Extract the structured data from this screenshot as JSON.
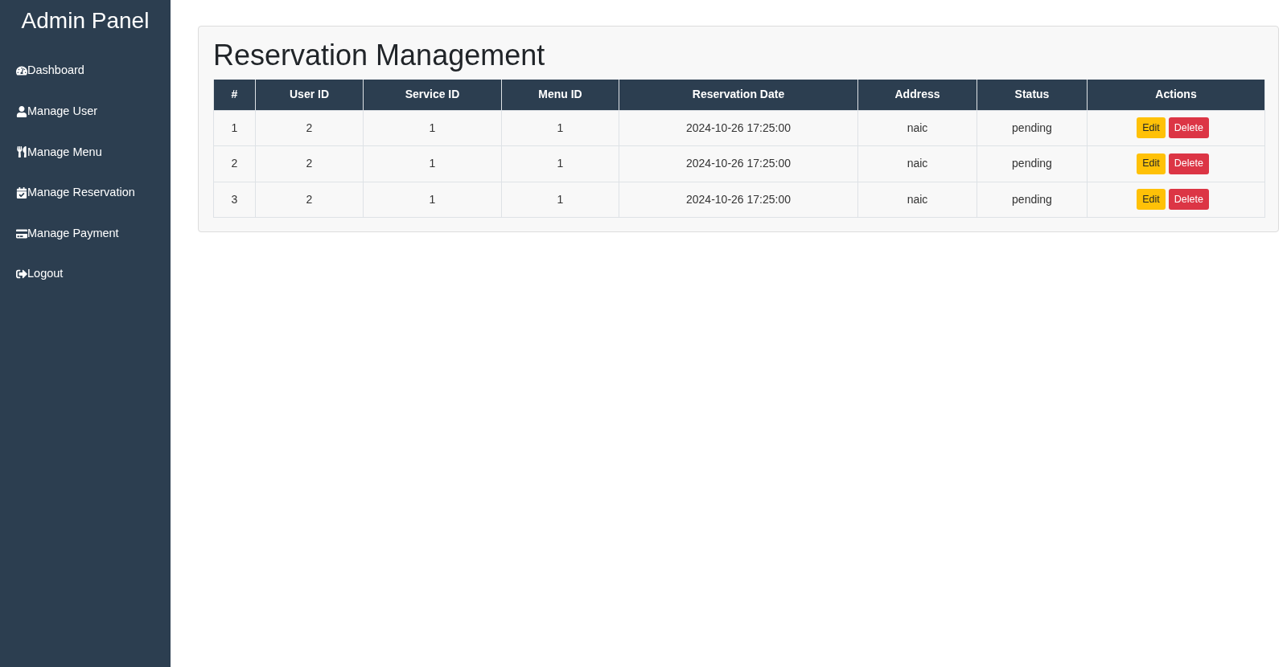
{
  "sidebar": {
    "title": "Admin Panel",
    "items": [
      {
        "kind": "dashboard",
        "label": "Dashboard"
      },
      {
        "kind": "user",
        "label": "Manage User"
      },
      {
        "kind": "menu",
        "label": "Manage Menu"
      },
      {
        "kind": "reservation",
        "label": "Manage Reservation"
      },
      {
        "kind": "payment",
        "label": "Manage Payment"
      },
      {
        "kind": "logout",
        "label": "Logout"
      }
    ]
  },
  "main": {
    "title": "Reservation Management",
    "table": {
      "columns": [
        "#",
        "User ID",
        "Service ID",
        "Menu ID",
        "Reservation Date",
        "Address",
        "Status",
        "Actions"
      ],
      "rows": [
        {
          "cells": [
            "1",
            "2",
            "1",
            "1",
            "2024-10-26 17:25:00",
            "naic",
            "pending"
          ],
          "actions": [
            {
              "kind": "edit",
              "label": "Edit"
            },
            {
              "kind": "delete",
              "label": "Delete"
            }
          ]
        },
        {
          "cells": [
            "2",
            "2",
            "1",
            "1",
            "2024-10-26 17:25:00",
            "naic",
            "pending"
          ],
          "actions": [
            {
              "kind": "edit",
              "label": "Edit"
            },
            {
              "kind": "delete",
              "label": "Delete"
            }
          ]
        },
        {
          "cells": [
            "3",
            "2",
            "1",
            "1",
            "2024-10-26 17:25:00",
            "naic",
            "pending"
          ],
          "actions": [
            {
              "kind": "edit",
              "label": "Edit"
            },
            {
              "kind": "delete",
              "label": "Delete"
            }
          ]
        }
      ]
    }
  }
}
